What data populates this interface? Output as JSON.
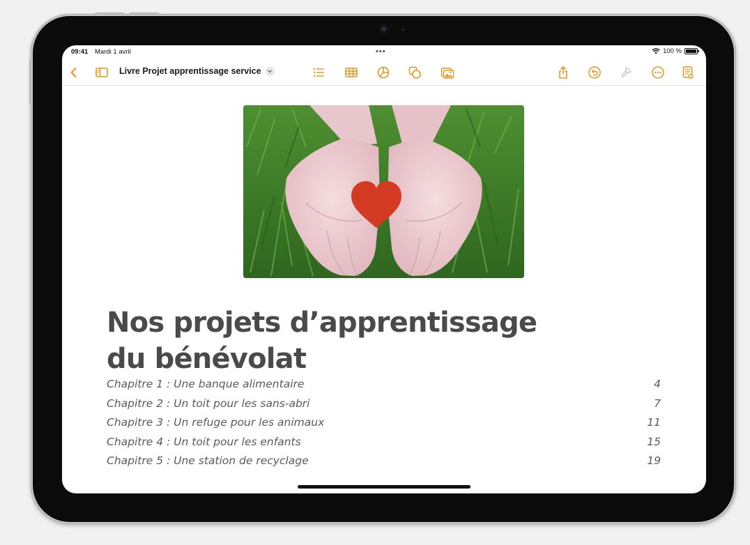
{
  "status_bar": {
    "time": "09:41",
    "date": "Mardi 1 avril",
    "multitask": "•••",
    "battery": "100 %"
  },
  "toolbar": {
    "title": "Livre Projet apprentissage service",
    "accent_color": "#e8961b",
    "left_icons": [
      "back-chevron-icon",
      "sidebar-icon"
    ],
    "insert_icons": [
      "list-icon",
      "table-icon",
      "chart-icon",
      "shape-icon",
      "media-icon"
    ],
    "right_icons": [
      "share-icon",
      "undo-icon",
      "format-brush-icon",
      "more-icon",
      "reading-view-icon"
    ]
  },
  "document": {
    "image": "hands-heart-photo",
    "heading_line1": "Nos projets d’apprentissage",
    "heading_line2": "du bénévolat",
    "toc": [
      {
        "title": "Chapitre 1 : Une banque alimentaire",
        "page": "4"
      },
      {
        "title": "Chapitre 2 : Un toit pour les sans-abri",
        "page": "7"
      },
      {
        "title": "Chapitre 3 : Un refuge pour les animaux",
        "page": "11"
      },
      {
        "title": "Chapitre 4 : Un toit pour les enfants",
        "page": "15"
      },
      {
        "title": "Chapitre 5 : Une station de recyclage",
        "page": "19"
      }
    ]
  }
}
